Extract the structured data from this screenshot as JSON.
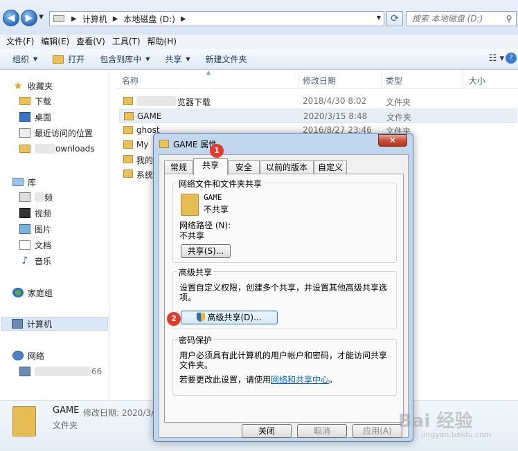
{
  "address_bar": {
    "crumbs": [
      "计算机",
      "本地磁盘 (D:)"
    ],
    "search_placeholder": "搜索 本地磁盘 (D:)"
  },
  "menu": [
    "文件(F)",
    "编辑(E)",
    "查看(V)",
    "工具(T)",
    "帮助(H)"
  ],
  "toolbar": {
    "organize": "组织",
    "open": "打开",
    "include_in_library": "包含到库中",
    "share": "共享",
    "new_folder": "新建文件夹"
  },
  "nav": {
    "favorites": "收藏夹",
    "downloads": "下载",
    "desktop": "桌面",
    "recent": "最近访问的位置",
    "downloads2_suffix": "ownloads",
    "libraries": "库",
    "lib_blur_suffix": "频",
    "videos": "视频",
    "pictures": "图片",
    "documents": "文档",
    "music": "音乐",
    "homegroup": "家庭组",
    "computer": "计算机",
    "network": "网络",
    "net_suffix": "66"
  },
  "columns": {
    "name": "名称",
    "date": "修改日期",
    "type": "类型",
    "size": "大小"
  },
  "files": [
    {
      "name": "览器下载",
      "date": "2018/4/30 8:02",
      "type": "文件夹"
    },
    {
      "name": "GAME",
      "date": "2020/3/15 8:48",
      "type": "文件夹"
    },
    {
      "name": "ghost",
      "date": "2016/8/27 23:46",
      "type": "文件夹"
    },
    {
      "name": "My",
      "date": "",
      "type": ""
    },
    {
      "name": "我的",
      "date": "",
      "type": ""
    },
    {
      "name": "系统",
      "date": "",
      "type": ""
    }
  ],
  "details": {
    "name": "GAME",
    "meta": "修改日期: 2020/3/",
    "type": "文件夹"
  },
  "dialog": {
    "title": "GAME 属性",
    "close_glyph": "✕",
    "tabs": [
      "常规",
      "共享",
      "安全",
      "以前的版本",
      "自定义"
    ],
    "network_sharing": {
      "title": "网络文件和文件夹共享",
      "folder_name": "GAME",
      "status": "不共享",
      "path_label": "网络路径 (N):",
      "path_value": "不共享",
      "share_button": "共享(S)..."
    },
    "advanced_sharing": {
      "title": "高级共享",
      "description_line1": "设置自定义权限，创建多个共享，并设置其他高级共享选",
      "description_line2": "项。",
      "button": "高级共享(D)..."
    },
    "password": {
      "title": "密码保护",
      "line1": "用户必须具有此计算机的用户帐户和密码，才能访问共享",
      "line2": "文件夹。",
      "change_prefix": "若要更改此设置，请使用",
      "link": "网络和共享中心",
      "change_suffix": "。"
    },
    "buttons": {
      "close": "关闭",
      "cancel": "取消",
      "apply": "应用(A)"
    }
  },
  "badges": [
    "1",
    "2"
  ],
  "watermark": {
    "main": "Bai 经验",
    "sub": "jingyan.baidu.com"
  }
}
